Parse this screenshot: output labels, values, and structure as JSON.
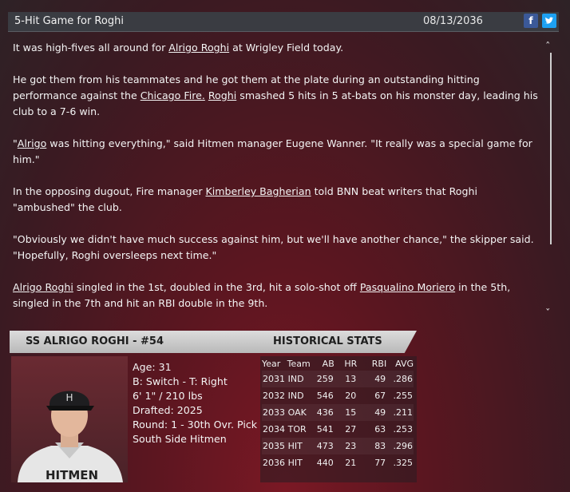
{
  "header": {
    "title": "5-Hit Game for Roghi",
    "date": "08/13/2036",
    "facebook_icon": "f",
    "twitter_icon": "bird"
  },
  "article": {
    "p1": {
      "a": "It was high-fives all around for ",
      "name": "Alrigo Roghi",
      "b": " at Wrigley Field  today."
    },
    "p2": {
      "a": "He got them from his teammates and he got them at the plate during an outstanding hitting performance against the ",
      "team": "Chicago Fire.",
      "b": " ",
      "name": "Roghi",
      "c": " smashed 5 hits in 5 at-bats on his monster day, leading his club to a 7-6 win."
    },
    "p3": {
      "q": "\"",
      "name": "Alrigo",
      "a": " was hitting everything,\" said Hitmen manager Eugene Wanner. \"It really was a special game for him.\""
    },
    "p4": {
      "a": "In the opposing dugout, Fire manager ",
      "name": "Kimberley Bagherian",
      "b": " told BNN beat writers that Roghi \"ambushed\" the club."
    },
    "p5": {
      "a": "\"Obviously we didn't have much success against him, but we'll have another chance,\" the skipper said. \"Hopefully, Roghi oversleeps next time.\""
    },
    "p6": {
      "name": "Alrigo Roghi",
      "a": " singled in the 1st, doubled in the 3rd, hit a solo-shot off ",
      "name2": "Pasqualino Moriero",
      "b": " in the 5th, singled in the 7th and hit an RBI double in the 9th."
    }
  },
  "player": {
    "heading": "SS ALRIGO ROGHI - #54",
    "age": "Age: 31",
    "bt": "B: Switch - T: Right",
    "size": "6' 1\" / 210 lbs",
    "drafted": "Drafted: 2025",
    "round": "Round: 1 - 30th Ovr. Pick",
    "team": "South Side Hitmen",
    "jersey_text": "HITMEN"
  },
  "stats": {
    "heading": "HISTORICAL STATS",
    "columns": [
      "Year",
      "Team",
      "AB",
      "HR",
      "RBI",
      "AVG"
    ],
    "rows": [
      [
        "2031",
        "IND",
        "259",
        "13",
        "49",
        ".286"
      ],
      [
        "2032",
        "IND",
        "546",
        "20",
        "67",
        ".255"
      ],
      [
        "2033",
        "OAK",
        "436",
        "15",
        "49",
        ".211"
      ],
      [
        "2034",
        "TOR",
        "541",
        "27",
        "63",
        ".253"
      ],
      [
        "2035",
        "HIT",
        "473",
        "23",
        "83",
        ".296"
      ],
      [
        "2036",
        "HIT",
        "440",
        "21",
        "77",
        ".325"
      ]
    ]
  },
  "colors": {
    "facebook": "#3b5998",
    "twitter": "#1da1f2",
    "header_bg": "#3a3c42"
  }
}
